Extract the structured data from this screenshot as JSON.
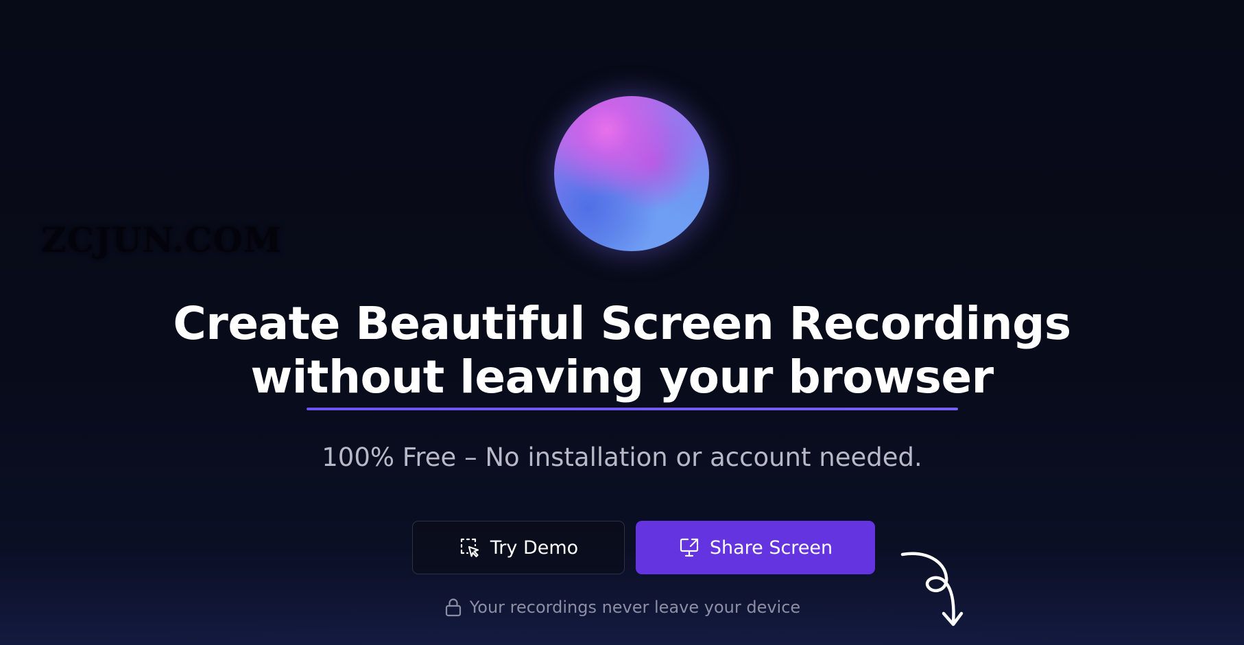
{
  "watermark": {
    "text": "ZCJUN.COM"
  },
  "hero": {
    "headline_line_1": "Create Beautiful Screen Recordings",
    "headline_line_2": "without leaving your browser",
    "subtitle": "100% Free – No installation or account needed."
  },
  "actions": {
    "try_demo_label": "Try Demo",
    "try_demo_icon": "dashed-select-cursor-icon",
    "share_screen_label": "Share Screen",
    "share_screen_icon": "screen-share-icon"
  },
  "privacy_note": {
    "text": "Your recordings never leave your device",
    "icon": "lock-icon"
  },
  "decor": {
    "arrow_icon": "curly-arrow-down-icon",
    "orb": "gradient-orb"
  },
  "colors": {
    "background": "#070a17",
    "accent": "#6434e0",
    "underline": "#6f52f0",
    "subtitle_text": "#b7b9c6",
    "muted_text": "#8c8fa3"
  }
}
